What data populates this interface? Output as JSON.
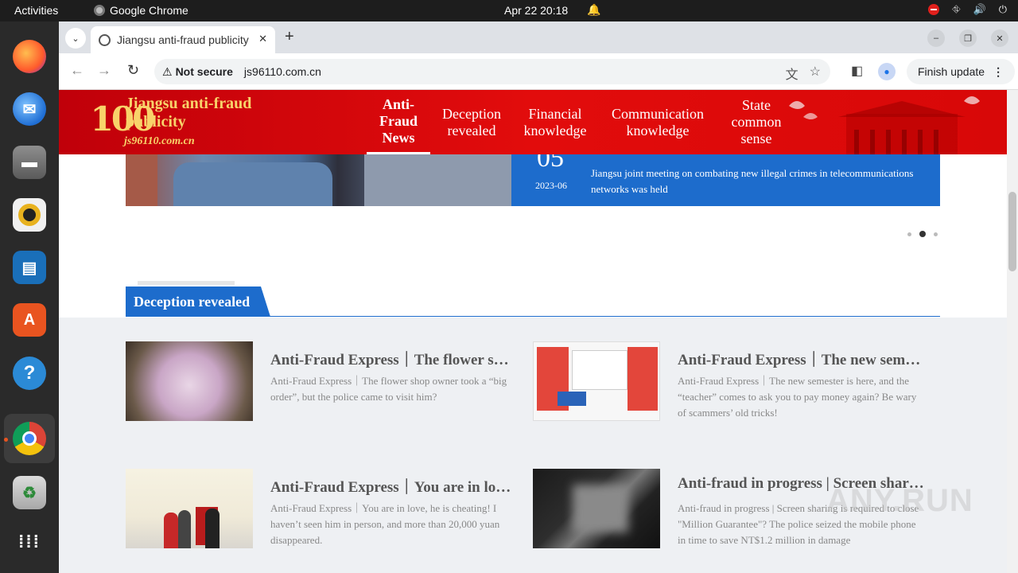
{
  "system_bar": {
    "activities": "Activities",
    "app_name": "Google Chrome",
    "datetime": "Apr 22  20:18"
  },
  "dock": {
    "items": [
      "firefox",
      "thunderbird",
      "files",
      "rhythmbox",
      "libreoffice-impress",
      "app-center",
      "help",
      "google-chrome",
      "trash",
      "show-apps"
    ]
  },
  "browser": {
    "tab_title": "Jiangsu anti-fraud publicity",
    "security_label": "Not secure",
    "url": "js96110.com.cn",
    "update_button": "Finish update"
  },
  "site": {
    "logo_mark": "100",
    "name": "Jiangsu anti-fraud publicity",
    "url": "js96110.com.cn",
    "nav": [
      {
        "label": "Anti-Fraud News",
        "active": true
      },
      {
        "label": "Deception revealed",
        "active": false
      },
      {
        "label": "Financial knowledge",
        "active": false
      },
      {
        "label": "Communication knowledge",
        "active": false
      },
      {
        "label": "State common sense",
        "active": false
      }
    ],
    "colors": {
      "header_red": "#e20c0c",
      "accent_blue": "#1d6ccc",
      "logo_gold": "#f8d36a"
    }
  },
  "carousel": {
    "day": "05",
    "date": "2023-06",
    "text": "Jiangsu joint meeting on combating new illegal crimes in telecommunications networks was held",
    "dot_count": 3,
    "active_dot": 2
  },
  "section": {
    "title": "Deception revealed",
    "articles": [
      {
        "title": "Anti-Fraud Express｜The flower shop owner took a “big order”, but the police came to visit him?",
        "desc": "Anti-Fraud Express｜The flower shop owner took a “big order”, but the police came to visit him?"
      },
      {
        "title": "Anti-Fraud Express｜The new semester is here, and the “teacher” comes to ask you to pay money again?",
        "desc": "Anti-Fraud Express｜The new semester is here, and the “teacher” comes to ask you to pay money again? Be wary of scammers’ old tricks!"
      },
      {
        "title": "Anti-Fraud Express｜You are in love, he is cheating!",
        "desc": "Anti-Fraud Express｜You are in love, he is cheating! I haven’t seen him in person, and more than 20,000 yuan disappeared."
      },
      {
        "title": "Anti-fraud in progress | Screen sharing is required to close \"Million Guarantee\"?",
        "desc": "Anti-fraud in progress | Screen sharing is required to close \"Million Guarantee\"? The police seized the mobile phone in time to save NT$1.2 million in damage"
      }
    ]
  },
  "watermark": "ANY.RUN"
}
